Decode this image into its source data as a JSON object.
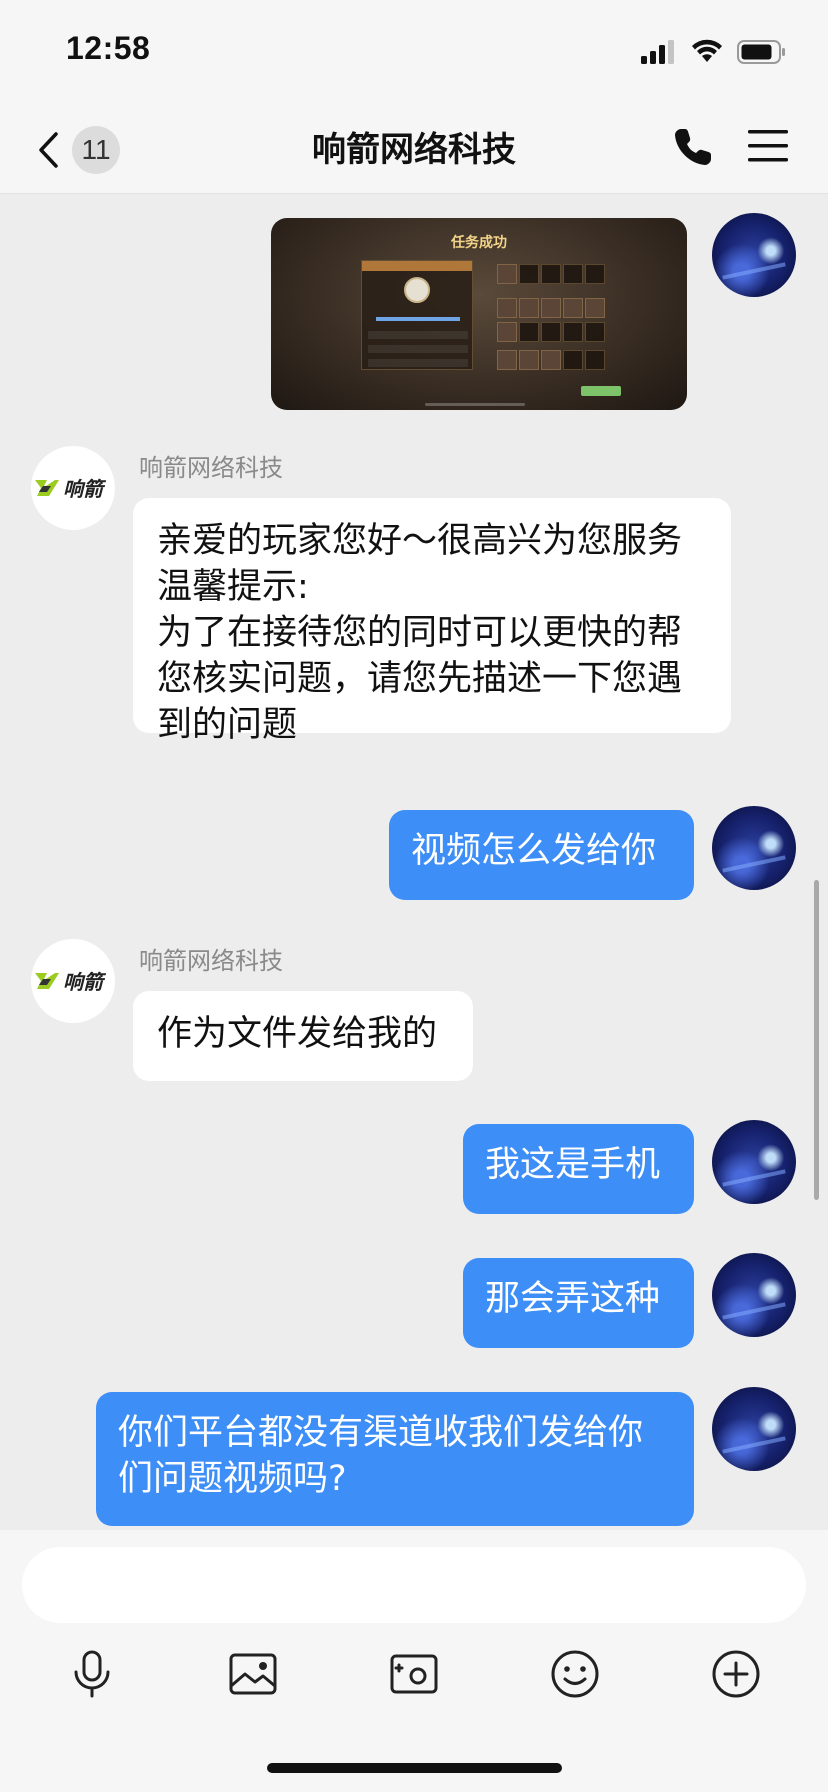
{
  "status_bar": {
    "time": "12:58"
  },
  "header": {
    "unread_count": "11",
    "title": "响箭网络科技"
  },
  "chat": {
    "brand_logo_text": "响箭",
    "messages": [
      {
        "side": "out",
        "type": "image",
        "image_title": "任务成功"
      },
      {
        "side": "in",
        "sender": "响箭网络科技",
        "text": "亲爱的玩家您好～很高兴为您服务\n温馨提示:\n为了在接待您的同时可以更快的帮您核实问题，请您先描述一下您遇到的问题"
      },
      {
        "side": "out",
        "text": "视频怎么发给你"
      },
      {
        "side": "in",
        "sender": "响箭网络科技",
        "text": "作为文件发给我的"
      },
      {
        "side": "out",
        "text": "我这是手机"
      },
      {
        "side": "out",
        "text": "那会弄这种"
      },
      {
        "side": "out",
        "text": "你们平台都没有渠道收我们发给你们问题视频吗?"
      }
    ]
  },
  "input": {
    "placeholder": ""
  },
  "toolbar": {
    "icons": [
      "microphone-icon",
      "image-icon",
      "camera-icon",
      "emoji-icon",
      "plus-icon"
    ]
  },
  "colors": {
    "outgoing_bubble": "#3d8ef7",
    "incoming_bubble": "#ffffff",
    "background": "#ededed",
    "brand_green": "#9acd1f"
  }
}
